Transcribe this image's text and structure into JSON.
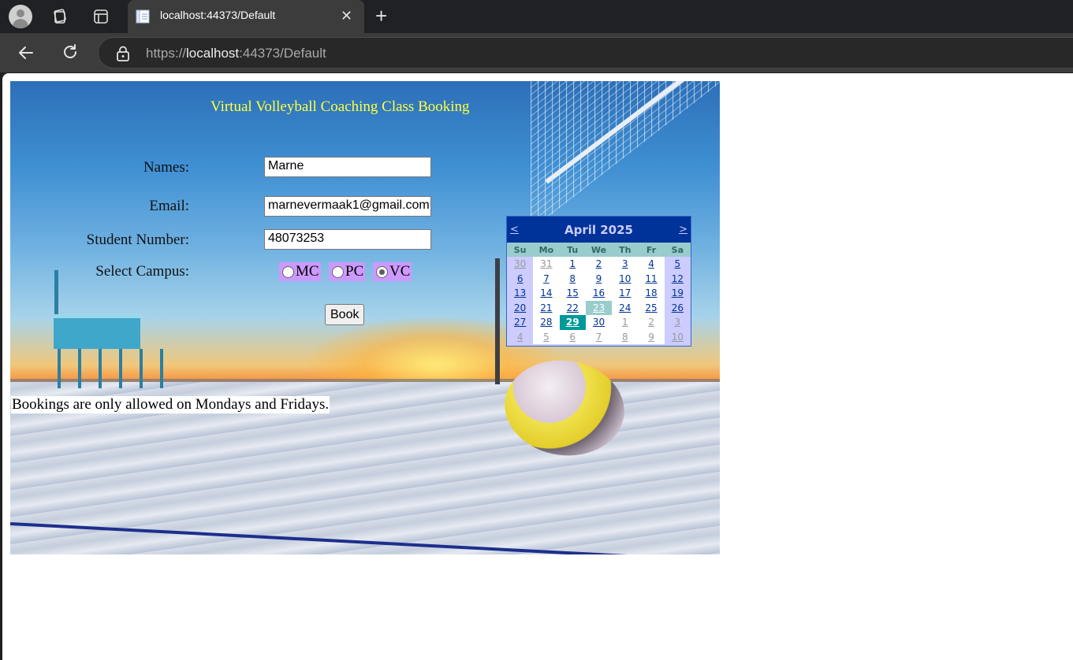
{
  "browser": {
    "tab_title": "localhost:44373/Default",
    "tab_close": "✕",
    "new_tab": "+",
    "url_scheme": "https://",
    "url_host": "localhost",
    "url_rest": ":44373/Default"
  },
  "page": {
    "title": "Virtual Volleyball Coaching Class Booking",
    "fields": {
      "names_label": "Names:",
      "names_value": "Marne",
      "email_label": "Email:",
      "email_value": "marnevermaak1@gmail.com",
      "student_label": "Student Number:",
      "student_value": "48073253",
      "campus_label": "Select Campus:"
    },
    "campus_options": [
      {
        "label": "MC",
        "checked": false
      },
      {
        "label": "PC",
        "checked": false
      },
      {
        "label": "VC",
        "checked": true
      }
    ],
    "book_button": "Book",
    "message": "Bookings are only allowed on Mondays and Fridays."
  },
  "calendar": {
    "prev": "<",
    "next": ">",
    "month": "April 2025",
    "weekdays": [
      "Su",
      "Mo",
      "Tu",
      "We",
      "Th",
      "Fr",
      "Sa"
    ],
    "weeks": [
      [
        "30",
        "31",
        "1",
        "2",
        "3",
        "4",
        "5"
      ],
      [
        "6",
        "7",
        "8",
        "9",
        "10",
        "11",
        "12"
      ],
      [
        "13",
        "14",
        "15",
        "16",
        "17",
        "18",
        "19"
      ],
      [
        "20",
        "21",
        "22",
        "23",
        "24",
        "25",
        "26"
      ],
      [
        "27",
        "28",
        "29",
        "30",
        "1",
        "2",
        "3"
      ],
      [
        "4",
        "5",
        "6",
        "7",
        "8",
        "9",
        "10"
      ]
    ],
    "today": "23",
    "selected": "29",
    "colors": {
      "header_bg": "#003399",
      "day_header_bg": "#99cccc",
      "weekend_bg": "#ccccff",
      "today_bg": "#99cccc",
      "selected_bg": "#009999"
    }
  },
  "icons": [
    "profile-avatar-icon",
    "collections-icon",
    "tab-actions-icon",
    "page-favicon-icon",
    "back-arrow-icon",
    "reload-icon",
    "lock-icon"
  ]
}
